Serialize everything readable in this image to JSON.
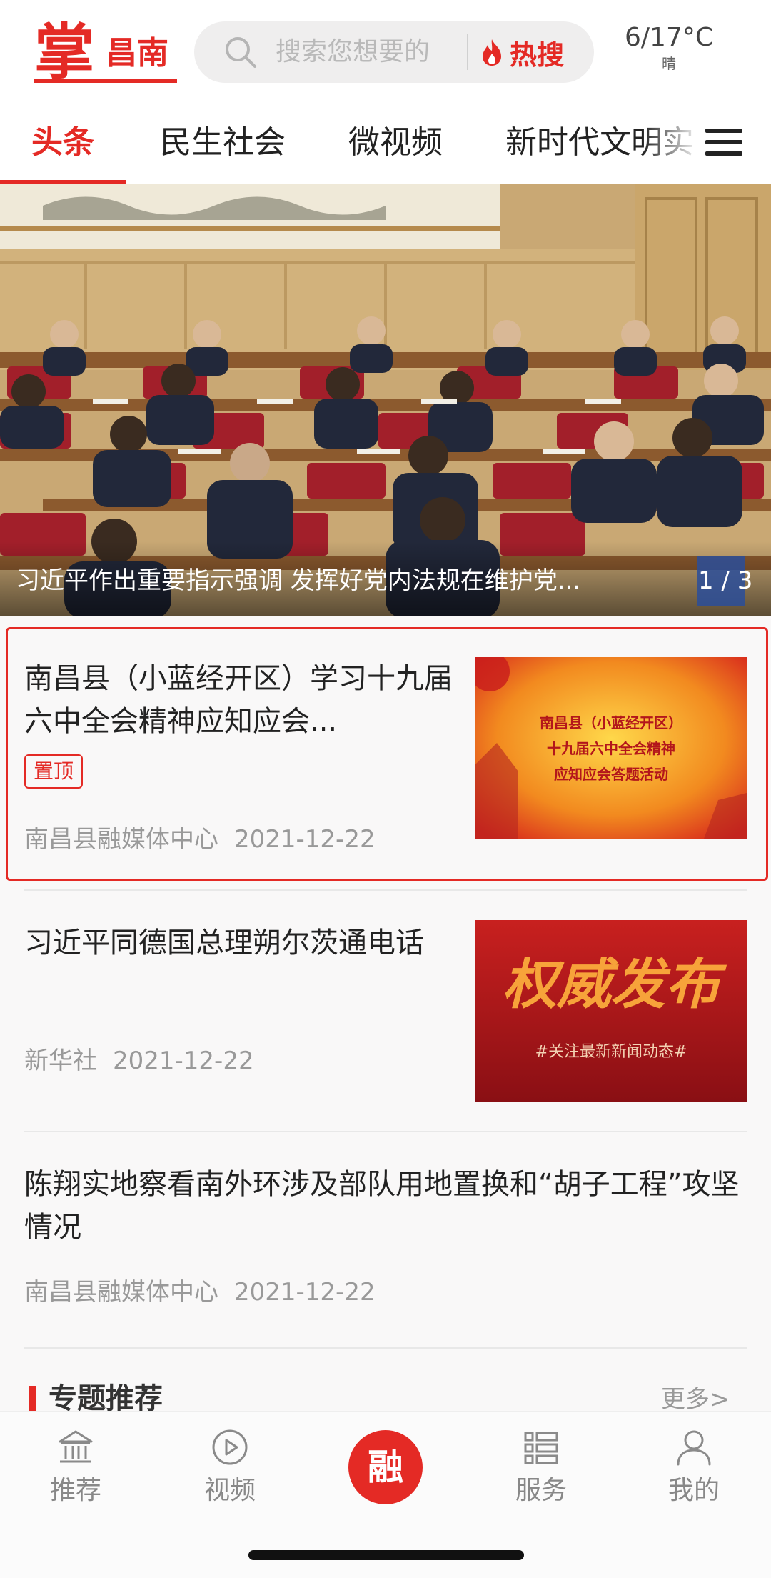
{
  "header": {
    "logo_big": "掌",
    "logo_small": "昌南",
    "search_placeholder": "搜索您想要的",
    "hot_search_label": "热搜",
    "weather_temp": "6/17°C",
    "weather_condition": "晴"
  },
  "tabs": [
    {
      "label": "头条",
      "active": true
    },
    {
      "label": "民生社会",
      "active": false
    },
    {
      "label": "微视频",
      "active": false
    },
    {
      "label": "新时代文明实",
      "active": false
    }
  ],
  "banner": {
    "caption": "习近平作出重要指示强调 发挥好党内法规在维护党...",
    "page_current": "1",
    "page_total": "3"
  },
  "news": [
    {
      "title": "南昌县（小蓝经开区）学习十九届六中全会精神应知应会...",
      "pinned_label": "置顶",
      "source": "南昌县融媒体中心",
      "date": "2021-12-22",
      "thumb_lines": [
        "南昌县（小蓝经开区）",
        "十九届六中全会精神",
        "应知应会答题活动"
      ]
    },
    {
      "title": "习近平同德国总理朔尔茨通电话",
      "source": "新华社",
      "date": "2021-12-22",
      "thumb_big": "权威发布",
      "thumb_small": "#关注最新新闻动态#"
    },
    {
      "title": "陈翔实地察看南外环涉及部队用地置换和“胡子工程”攻坚情况",
      "source": "南昌县融媒体中心",
      "date": "2021-12-22"
    }
  ],
  "topics": {
    "title": "专题推荐",
    "more": "更多>"
  },
  "bottom_nav": [
    {
      "label": "推荐",
      "icon": "building-icon"
    },
    {
      "label": "视频",
      "icon": "play-icon"
    },
    {
      "label": "融",
      "icon": "center-button"
    },
    {
      "label": "服务",
      "icon": "list-icon"
    },
    {
      "label": "我的",
      "icon": "user-icon"
    }
  ],
  "colors": {
    "brand_red": "#e42a25"
  }
}
